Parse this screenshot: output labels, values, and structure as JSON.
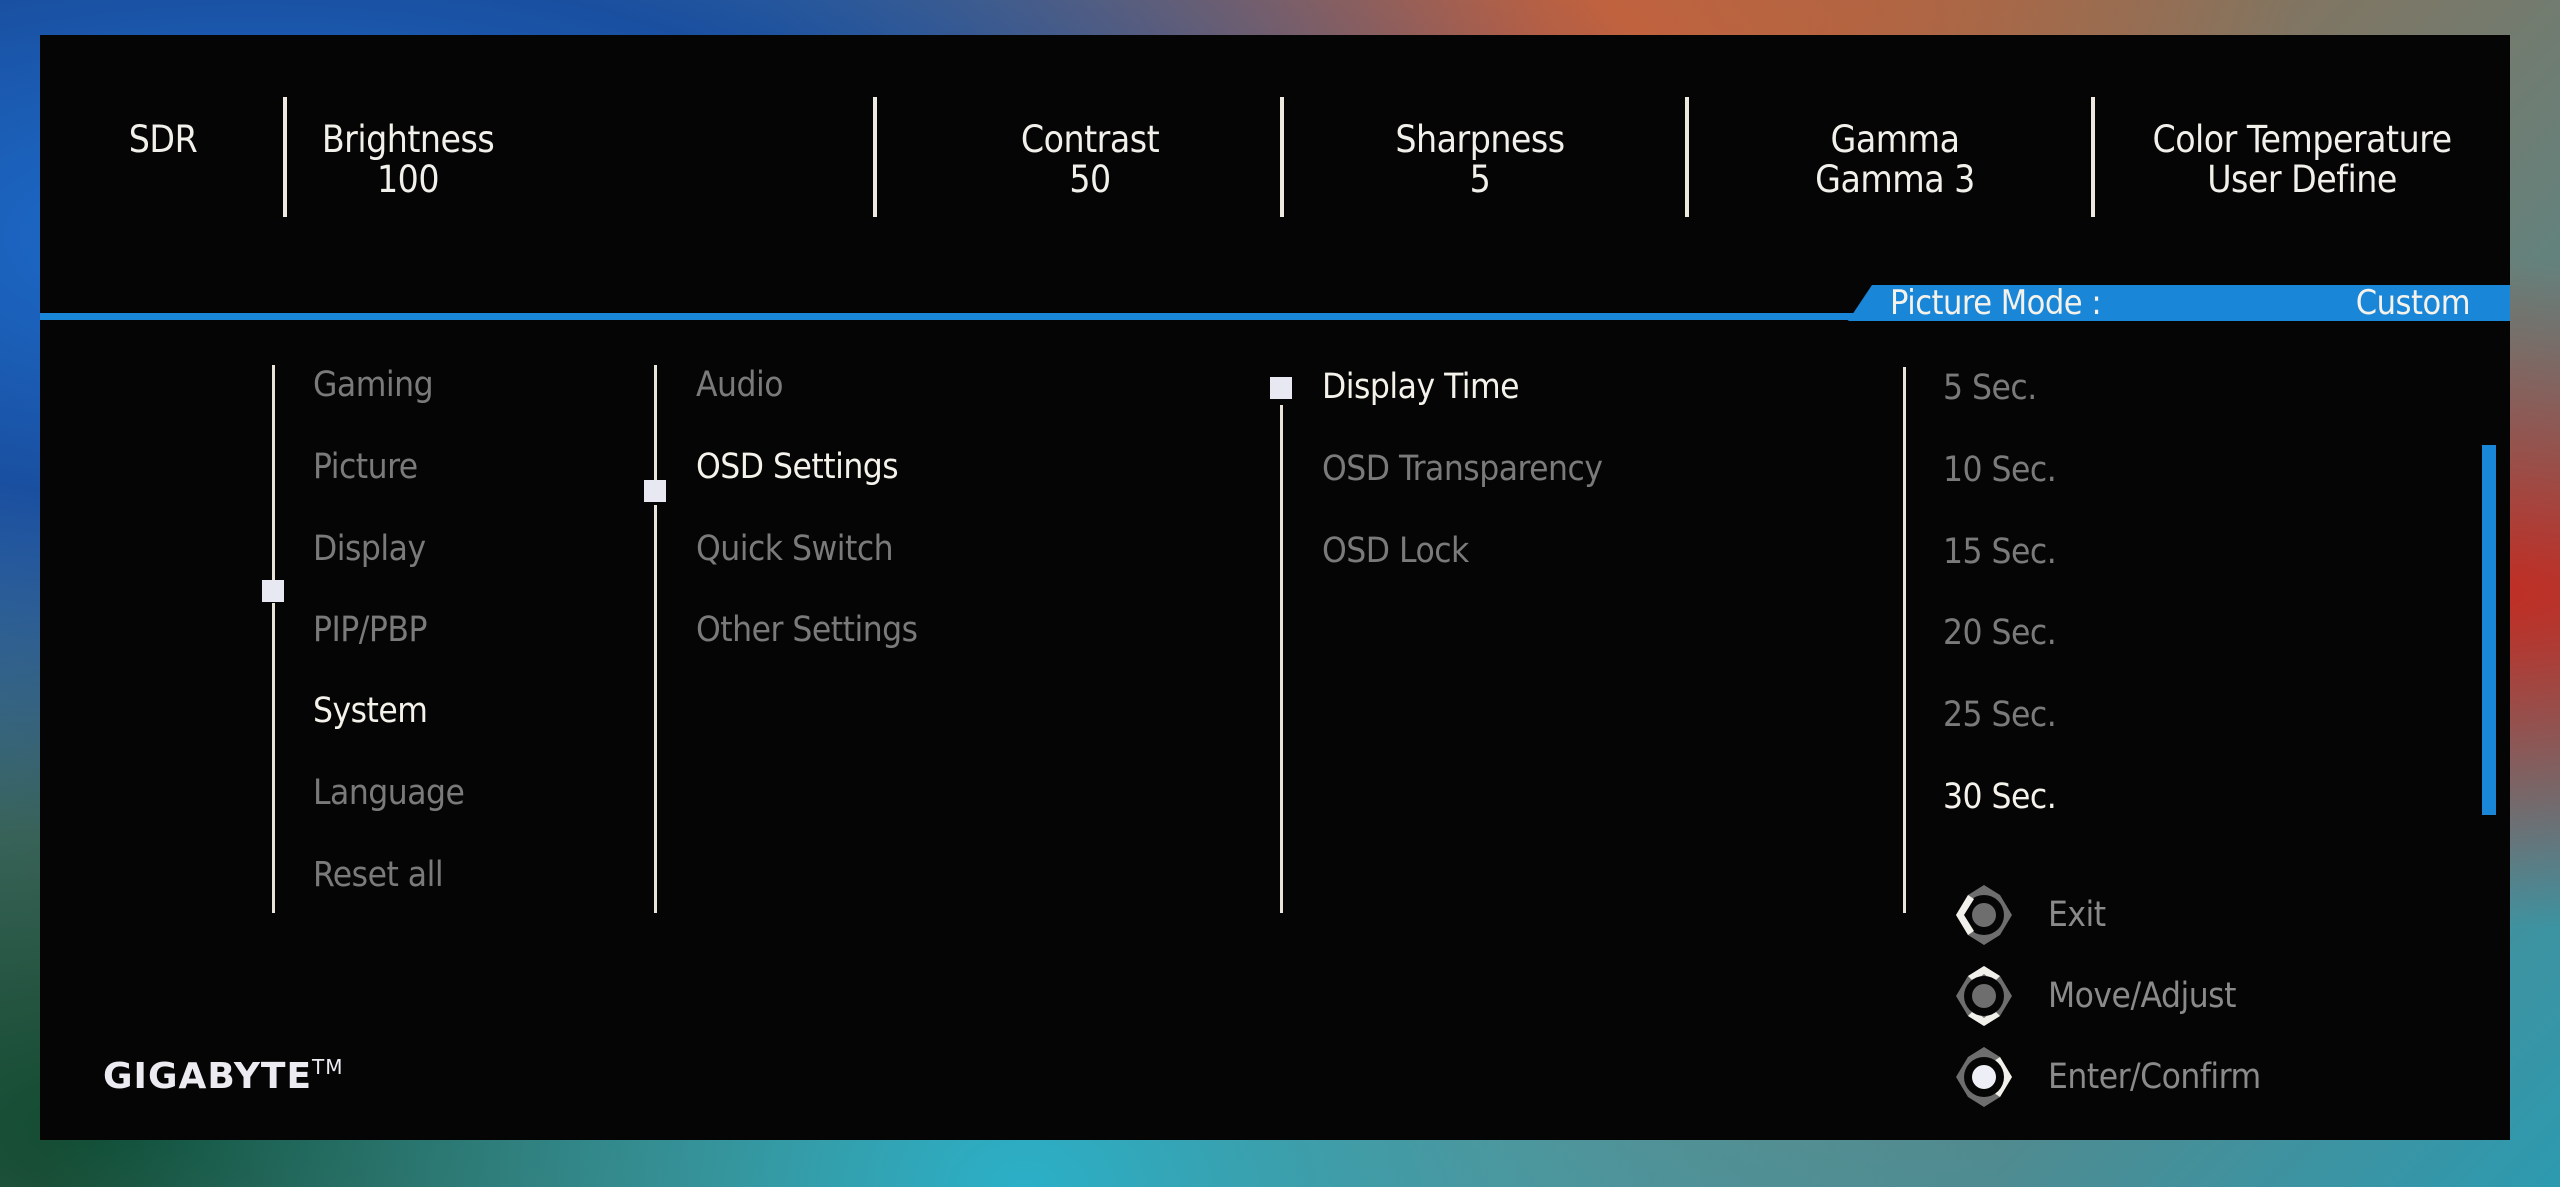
{
  "top_bar": {
    "items": [
      {
        "label": "SDR",
        "value": ""
      },
      {
        "label": "Brightness",
        "value": "100"
      },
      {
        "label": "Contrast",
        "value": "50"
      },
      {
        "label": "Sharpness",
        "value": "5"
      },
      {
        "label": "Gamma",
        "value": "Gamma 3"
      },
      {
        "label": "Color Temperature",
        "value": "User Define"
      }
    ]
  },
  "picture_mode": {
    "label": "Picture Mode  :",
    "value": "Custom"
  },
  "main_menu": {
    "items": [
      {
        "label": "Gaming",
        "active": false
      },
      {
        "label": "Picture",
        "active": false
      },
      {
        "label": "Display",
        "active": false
      },
      {
        "label": "PIP/PBP",
        "active": false
      },
      {
        "label": "System",
        "active": true
      },
      {
        "label": "Language",
        "active": false
      },
      {
        "label": "Reset all",
        "active": false
      }
    ]
  },
  "system_menu": {
    "items": [
      {
        "label": "Audio",
        "active": false
      },
      {
        "label": "OSD Settings",
        "active": true
      },
      {
        "label": "Quick Switch",
        "active": false
      },
      {
        "label": "Other Settings",
        "active": false
      }
    ]
  },
  "osd_menu": {
    "items": [
      {
        "label": "Display Time",
        "active": true
      },
      {
        "label": "OSD Transparency",
        "active": false
      },
      {
        "label": "OSD Lock",
        "active": false
      }
    ]
  },
  "display_time_options": {
    "items": [
      {
        "label": "5 Sec.",
        "active": false
      },
      {
        "label": "10 Sec.",
        "active": false
      },
      {
        "label": "15 Sec.",
        "active": false
      },
      {
        "label": "20 Sec.",
        "active": false
      },
      {
        "label": "25 Sec.",
        "active": false
      },
      {
        "label": "30 Sec.",
        "active": true
      }
    ],
    "selected": "30 Sec."
  },
  "hints": [
    {
      "icon": "joystick-left-icon",
      "label": "Exit"
    },
    {
      "icon": "joystick-up-down-icon",
      "label": "Move/Adjust"
    },
    {
      "icon": "joystick-press-icon",
      "label": "Enter/Confirm"
    }
  ],
  "brand": {
    "name": "GIGABYTE",
    "mark": "TM"
  },
  "colors": {
    "accent": "#1a86d8",
    "panel": "#050505",
    "active_text": "#f4f2ea",
    "inactive_text": "#7a7a7a"
  }
}
